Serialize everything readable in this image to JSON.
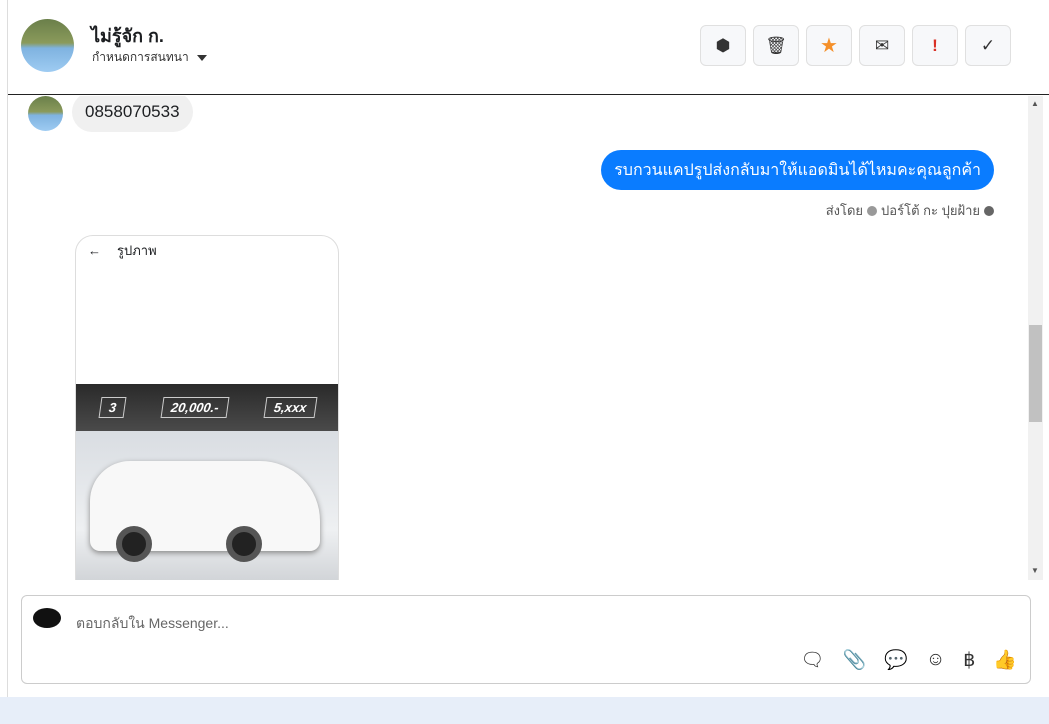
{
  "header": {
    "name": "ไม่รู้จัก ก.",
    "subtitle": "กำหนดการสนทนา",
    "actions": [
      {
        "name": "spam",
        "icon": "⬢",
        "color": "#333"
      },
      {
        "name": "delete",
        "icon": "🗑",
        "color": "#333"
      },
      {
        "name": "star",
        "icon": "★",
        "color": "#f5902a"
      },
      {
        "name": "mail",
        "icon": "✉",
        "color": "#333"
      },
      {
        "name": "important",
        "icon": "!",
        "color": "#d93025"
      },
      {
        "name": "done",
        "icon": "✓",
        "color": "#333"
      }
    ]
  },
  "messages": {
    "incoming": "0858070533",
    "outgoing": "รบกวนแคปรูปส่งกลับมาให้แอดมินได้ไหมคะคุณลูกค้า",
    "sent_by_label": "ส่งโดย",
    "sent_by_name": "ปอร์โต้ กะ ปุยฝ้าย"
  },
  "image_card": {
    "title": "รูปภาพ",
    "box1": "3",
    "box2": "20,000.-",
    "box3": "5,xxx"
  },
  "composer": {
    "placeholder": "ตอบกลับใน Messenger...",
    "baht": "฿"
  }
}
